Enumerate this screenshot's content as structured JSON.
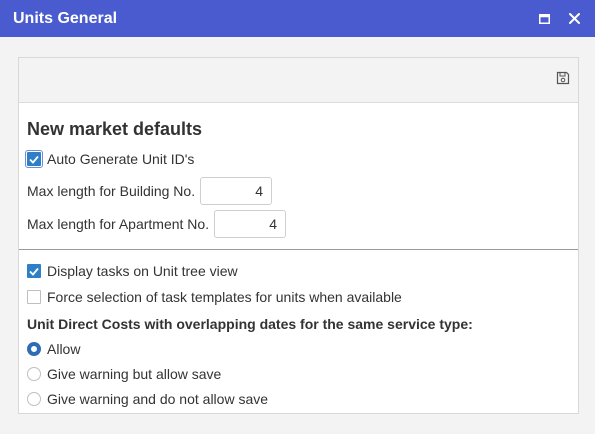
{
  "window": {
    "title": "Units General"
  },
  "section": {
    "heading": "New market defaults"
  },
  "auto_generate": {
    "label": "Auto Generate Unit ID's",
    "checked": true
  },
  "building": {
    "label": "Max length for Building No.",
    "value": "4"
  },
  "apartment": {
    "label": "Max length for Apartment No.",
    "value": "4"
  },
  "display_tasks": {
    "label": "Display tasks on Unit tree view",
    "checked": true
  },
  "force_selection": {
    "label": "Force selection of task templates for units when available",
    "checked": false
  },
  "overlap": {
    "label": "Unit Direct Costs with overlapping dates for the same service type:",
    "options": [
      {
        "label": "Allow",
        "selected": true
      },
      {
        "label": "Give warning but allow save",
        "selected": false
      },
      {
        "label": "Give warning and do not allow save",
        "selected": false
      }
    ]
  },
  "colors": {
    "titlebar": "#4a5bd0",
    "accent": "#2e7fc7"
  }
}
